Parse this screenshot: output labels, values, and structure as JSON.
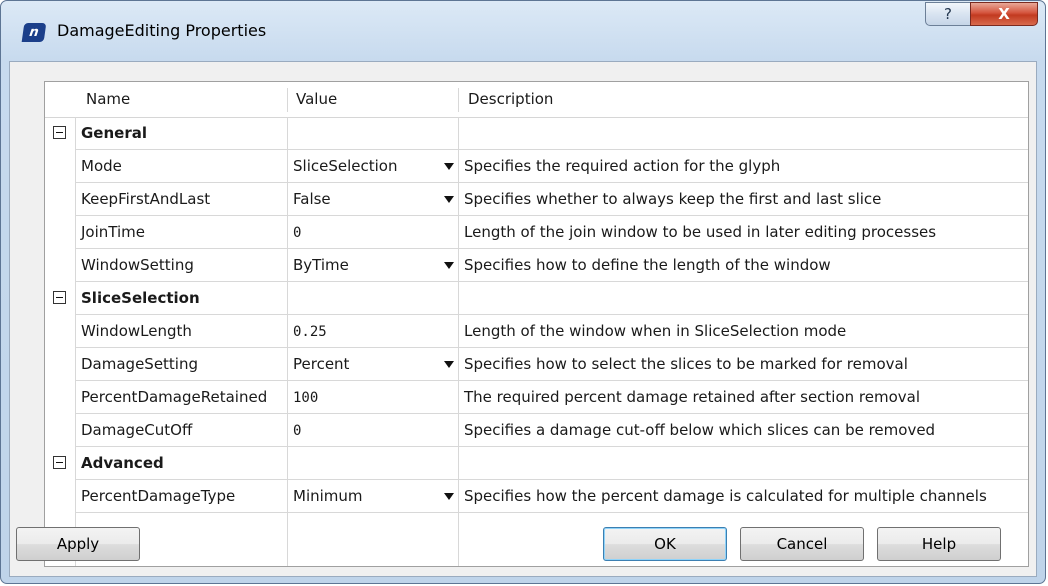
{
  "window": {
    "title": "DamageEditing Properties",
    "icon": "nv-logo-icon",
    "help_glyph": "?",
    "close_glyph": "X"
  },
  "grid": {
    "columns": [
      "Name",
      "Value",
      "Description"
    ],
    "categories": [
      {
        "label": "General",
        "rows": [
          {
            "name": "Mode",
            "value": "SliceSelection",
            "dropdown": true,
            "description": "Specifies the required action for the glyph"
          },
          {
            "name": "KeepFirstAndLast",
            "value": "False",
            "dropdown": true,
            "description": "Specifies whether to always keep the first and last slice"
          },
          {
            "name": "JoinTime",
            "value": "0",
            "dropdown": false,
            "description": "Length of the join window to be used in later editing processes"
          },
          {
            "name": "WindowSetting",
            "value": "ByTime",
            "dropdown": true,
            "description": "Specifies how to define the length of the window"
          }
        ]
      },
      {
        "label": "SliceSelection",
        "rows": [
          {
            "name": "WindowLength",
            "value": "0.25",
            "dropdown": false,
            "description": "Length of the window when in SliceSelection mode"
          },
          {
            "name": "DamageSetting",
            "value": "Percent",
            "dropdown": true,
            "description": "Specifies how to select the slices to be marked for removal"
          },
          {
            "name": "PercentDamageRetained",
            "value": "100",
            "dropdown": false,
            "description": "The required percent damage retained after section removal"
          },
          {
            "name": "DamageCutOff",
            "value": "0",
            "dropdown": false,
            "description": "Specifies a damage cut-off below which slices can be removed"
          }
        ]
      },
      {
        "label": "Advanced",
        "rows": [
          {
            "name": "PercentDamageType",
            "value": "Minimum",
            "dropdown": true,
            "description": "Specifies how the percent damage is calculated for multiple channels"
          }
        ]
      }
    ]
  },
  "buttons": {
    "apply": "Apply",
    "ok": "OK",
    "cancel": "Cancel",
    "help": "Help"
  }
}
